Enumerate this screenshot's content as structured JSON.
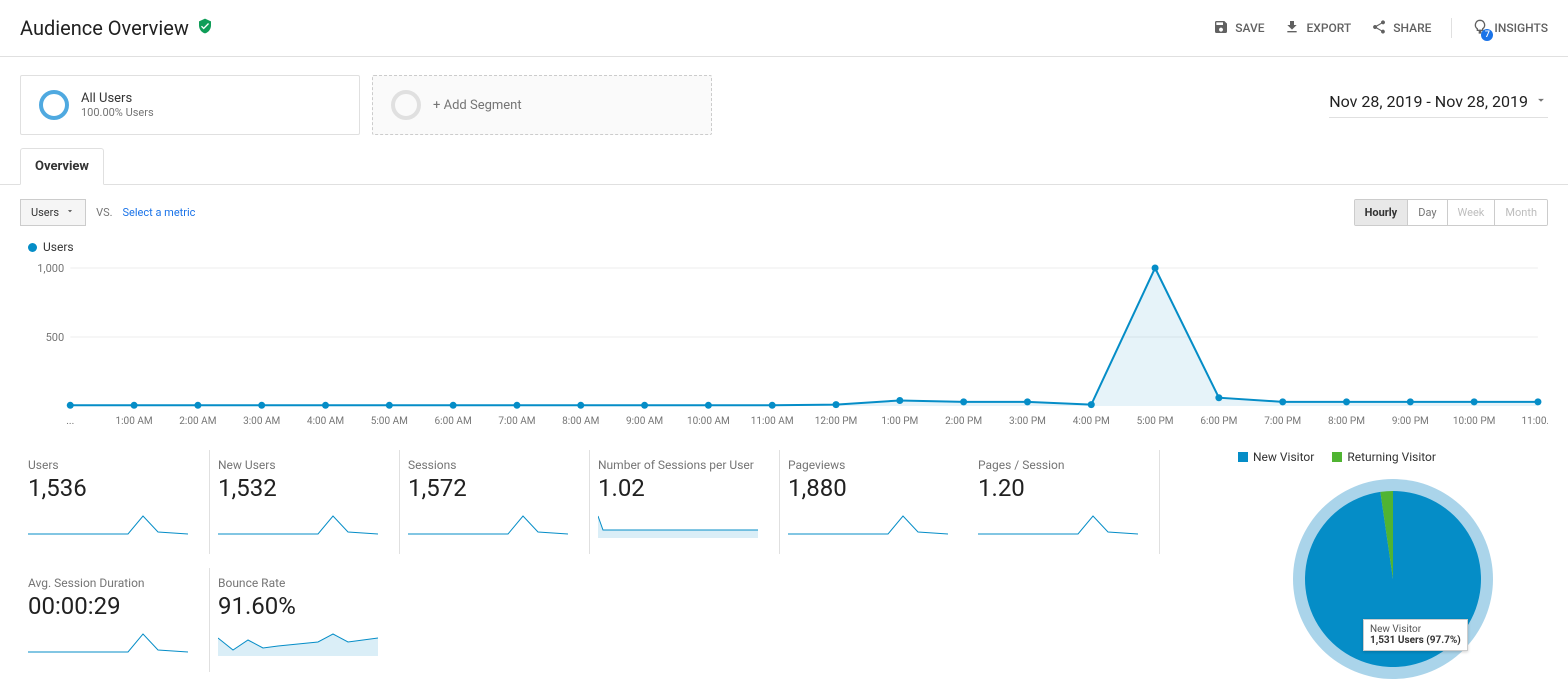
{
  "page_title": "Audience Overview",
  "header_actions": {
    "save": "SAVE",
    "export": "EXPORT",
    "share": "SHARE",
    "insights": "INSIGHTS",
    "insights_count": "7"
  },
  "segments": {
    "primary_title": "All Users",
    "primary_sub": "100.00% Users",
    "add_label": "+ Add Segment"
  },
  "date_range": "Nov 28, 2019 - Nov 28, 2019",
  "tab_label": "Overview",
  "metric_selector": "Users",
  "vs_label": "VS.",
  "select_metric_label": "Select a metric",
  "granularity": {
    "hourly": "Hourly",
    "day": "Day",
    "week": "Week",
    "month": "Month"
  },
  "chart_legend_label": "Users",
  "chart_data": {
    "type": "line",
    "ylabel": "",
    "ylim": [
      0,
      1000
    ],
    "yticks": [
      500,
      1000
    ],
    "categories": [
      "...",
      "1:00 AM",
      "2:00 AM",
      "3:00 AM",
      "4:00 AM",
      "5:00 AM",
      "6:00 AM",
      "7:00 AM",
      "8:00 AM",
      "9:00 AM",
      "10:00 AM",
      "11:00 AM",
      "12:00 PM",
      "1:00 PM",
      "2:00 PM",
      "3:00 PM",
      "4:00 PM",
      "5:00 PM",
      "6:00 PM",
      "7:00 PM",
      "8:00 PM",
      "9:00 PM",
      "10:00 PM",
      "11:00..."
    ],
    "values": [
      5,
      5,
      5,
      5,
      5,
      5,
      5,
      5,
      5,
      5,
      5,
      5,
      10,
      40,
      30,
      30,
      10,
      1050,
      60,
      30,
      30,
      30,
      30,
      30
    ]
  },
  "metrics": [
    {
      "label": "Users",
      "value": "1,536",
      "spark_type": "line"
    },
    {
      "label": "New Users",
      "value": "1,532",
      "spark_type": "line"
    },
    {
      "label": "Sessions",
      "value": "1,572",
      "spark_type": "line"
    },
    {
      "label": "Number of Sessions per User",
      "value": "1.02",
      "spark_type": "area"
    },
    {
      "label": "Pageviews",
      "value": "1,880",
      "spark_type": "line"
    },
    {
      "label": "Pages / Session",
      "value": "1.20",
      "spark_type": "line"
    },
    {
      "label": "Avg. Session Duration",
      "value": "00:00:29",
      "spark_type": "line"
    },
    {
      "label": "Bounce Rate",
      "value": "91.60%",
      "spark_type": "area"
    }
  ],
  "pie_legend": {
    "new": "New Visitor",
    "returning": "Returning Visitor"
  },
  "pie_data": {
    "type": "pie",
    "series": [
      {
        "name": "New Visitor",
        "value": 1531,
        "percent": 97.7,
        "color": "#058dc7"
      },
      {
        "name": "Returning Visitor",
        "value": 36,
        "percent": 2.3,
        "color": "#50b432"
      }
    ]
  },
  "pie_tooltip": {
    "title": "New Visitor",
    "value": "1,531 Users (97.7%)"
  }
}
